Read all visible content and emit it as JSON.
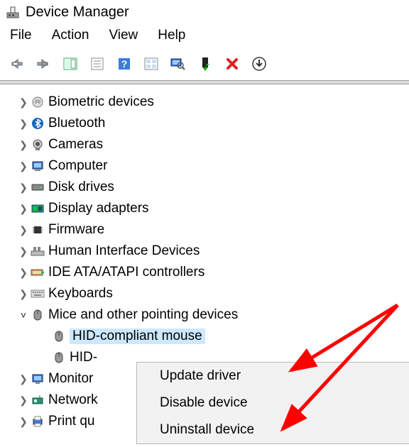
{
  "window": {
    "title": "Device Manager"
  },
  "menu": {
    "file": "File",
    "action": "Action",
    "view": "View",
    "help": "Help"
  },
  "tree": {
    "items": [
      {
        "label": "Biometric devices"
      },
      {
        "label": "Bluetooth"
      },
      {
        "label": "Cameras"
      },
      {
        "label": "Computer"
      },
      {
        "label": "Disk drives"
      },
      {
        "label": "Display adapters"
      },
      {
        "label": "Firmware"
      },
      {
        "label": "Human Interface Devices"
      },
      {
        "label": "IDE ATA/ATAPI controllers"
      },
      {
        "label": "Keyboards"
      },
      {
        "label": "Mice and other pointing devices"
      },
      {
        "label": "Monitor"
      },
      {
        "label": "Network"
      },
      {
        "label": "Print qu"
      }
    ],
    "mice_children": [
      {
        "label": "HID-compliant mouse"
      },
      {
        "label": "HID-"
      }
    ]
  },
  "context_menu": {
    "update": "Update driver",
    "disable": "Disable device",
    "uninstall": "Uninstall device"
  }
}
